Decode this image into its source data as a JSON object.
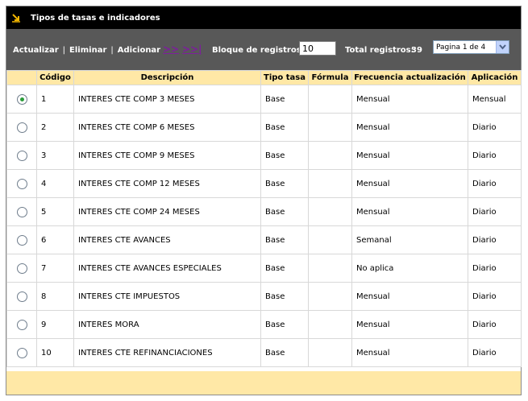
{
  "header": {
    "title": "Tipos de tasas e indicadores"
  },
  "toolbar": {
    "actualizar": "Actualizar",
    "eliminar": "Eliminar",
    "adicionar": "Adicionar",
    "separator": "|",
    "next": ">>",
    "last": ">>|",
    "block_label": "Bloque de registros:",
    "block_value": "10",
    "total_label": "Total registros:",
    "total_value": "39",
    "page_select": "Pagina 1 de 4"
  },
  "table": {
    "columns": [
      "Código",
      "Descripción",
      "Tipo tasa",
      "Fórmula",
      "Frecuencia actualización",
      "Aplicación"
    ],
    "rows": [
      {
        "selected": true,
        "codigo": "1",
        "descripcion": "INTERES CTE COMP 3 MESES",
        "tipo": "Base",
        "formula": "",
        "frecuencia": "Mensual",
        "aplicacion": "Mensual"
      },
      {
        "selected": false,
        "codigo": "2",
        "descripcion": "INTERES CTE COMP 6 MESES",
        "tipo": "Base",
        "formula": "",
        "frecuencia": "Mensual",
        "aplicacion": "Diario"
      },
      {
        "selected": false,
        "codigo": "3",
        "descripcion": "INTERES CTE COMP 9 MESES",
        "tipo": "Base",
        "formula": "",
        "frecuencia": "Mensual",
        "aplicacion": "Diario"
      },
      {
        "selected": false,
        "codigo": "4",
        "descripcion": "INTERES CTE COMP 12 MESES",
        "tipo": "Base",
        "formula": "",
        "frecuencia": "Mensual",
        "aplicacion": "Diario"
      },
      {
        "selected": false,
        "codigo": "5",
        "descripcion": "INTERES CTE COMP 24 MESES",
        "tipo": "Base",
        "formula": "",
        "frecuencia": "Mensual",
        "aplicacion": "Diario"
      },
      {
        "selected": false,
        "codigo": "6",
        "descripcion": "INTERES CTE AVANCES",
        "tipo": "Base",
        "formula": "",
        "frecuencia": "Semanal",
        "aplicacion": "Diario"
      },
      {
        "selected": false,
        "codigo": "7",
        "descripcion": "INTERES CTE AVANCES ESPECIALES",
        "tipo": "Base",
        "formula": "",
        "frecuencia": "No aplica",
        "aplicacion": "Diario"
      },
      {
        "selected": false,
        "codigo": "8",
        "descripcion": "INTERES CTE IMPUESTOS",
        "tipo": "Base",
        "formula": "",
        "frecuencia": "Mensual",
        "aplicacion": "Diario"
      },
      {
        "selected": false,
        "codigo": "9",
        "descripcion": "INTERES MORA",
        "tipo": "Base",
        "formula": "",
        "frecuencia": "Mensual",
        "aplicacion": "Diario"
      },
      {
        "selected": false,
        "codigo": "10",
        "descripcion": "INTERES CTE REFINANCIACIONES",
        "tipo": "Base",
        "formula": "",
        "frecuencia": "Mensual",
        "aplicacion": "Diario"
      }
    ]
  },
  "colors": {
    "title_bg": "#000000",
    "toolbar_bg": "#585858",
    "header_bg": "#ffe8a6",
    "nav_link": "#7d1f9c",
    "icon_accent": "#f0b400"
  },
  "icons": {
    "title": "arrow-down-right-icon",
    "select": "chevron-down-icon",
    "radio": "radio-icon"
  }
}
